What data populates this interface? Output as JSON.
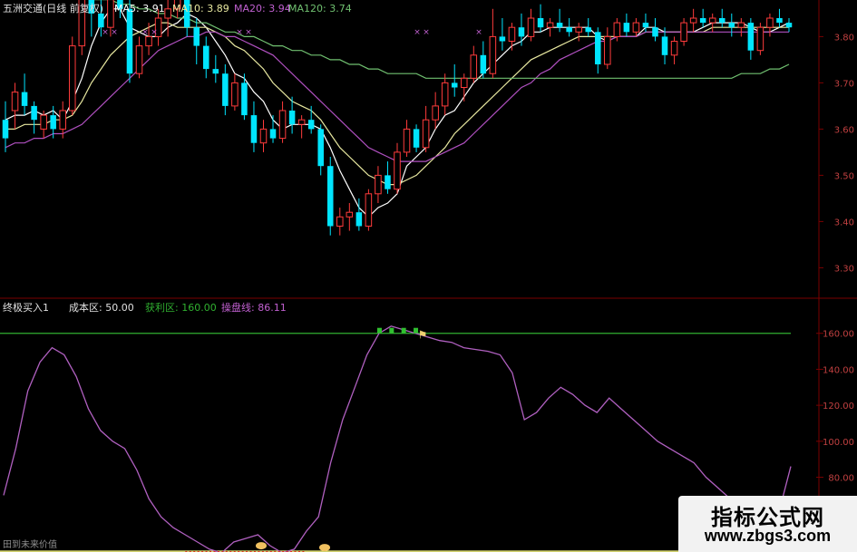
{
  "header": {
    "stock_name": "五洲交通(日线 前复权)",
    "ma5": "MA5: 3.91",
    "ma10": "MA10: 3.89",
    "ma20": "MA20: 3.94",
    "ma120": "MA120: 3.74"
  },
  "indicator_header": {
    "name": "终极买入1",
    "cost": "成本区: 50.00",
    "profit": "获利区: 160.00",
    "line": "操盘线: 86.11"
  },
  "bottom_label": "田到未来价值",
  "watermark": {
    "line1": "指标公式网",
    "line2": "www.zbgs3.com"
  },
  "colors": {
    "up": "#ff3b3b",
    "down": "#00e5ff",
    "ma5": "#ffffff",
    "ma10": "#e8e8a0",
    "ma20": "#b050c0",
    "ma120": "#70c070",
    "osc": "#b060c0",
    "grid": "#7a0000",
    "axis_text": "#c04040",
    "green_line": "#30b030",
    "yellow_line": "#f0f080"
  },
  "chart_data": [
    {
      "type": "candlestick",
      "title": "五洲交通(日线 前复权)",
      "yticks": [
        3.3,
        3.4,
        3.5,
        3.6,
        3.7,
        3.8
      ],
      "ylim": [
        3.24,
        3.84
      ],
      "ohlc": [
        [
          3.62,
          3.66,
          3.55,
          3.58
        ],
        [
          3.64,
          3.7,
          3.6,
          3.68
        ],
        [
          3.68,
          3.72,
          3.63,
          3.65
        ],
        [
          3.65,
          3.66,
          3.59,
          3.62
        ],
        [
          3.6,
          3.64,
          3.58,
          3.63
        ],
        [
          3.63,
          3.65,
          3.58,
          3.6
        ],
        [
          3.6,
          3.66,
          3.58,
          3.64
        ],
        [
          3.64,
          3.8,
          3.63,
          3.78
        ],
        [
          3.78,
          3.93,
          3.76,
          3.9
        ],
        [
          3.9,
          3.94,
          3.8,
          3.85
        ],
        [
          3.85,
          3.88,
          3.8,
          3.82
        ],
        [
          3.82,
          3.92,
          3.8,
          3.88
        ],
        [
          3.88,
          3.98,
          3.84,
          3.86
        ],
        [
          3.86,
          3.9,
          3.7,
          3.72
        ],
        [
          3.72,
          3.8,
          3.71,
          3.78
        ],
        [
          3.78,
          3.83,
          3.76,
          3.8
        ],
        [
          3.8,
          3.86,
          3.78,
          3.84
        ],
        [
          3.84,
          3.89,
          3.8,
          3.86
        ],
        [
          3.86,
          3.91,
          3.84,
          3.89
        ],
        [
          3.89,
          3.92,
          3.8,
          3.82
        ],
        [
          3.82,
          3.84,
          3.74,
          3.78
        ],
        [
          3.78,
          3.8,
          3.71,
          3.73
        ],
        [
          3.73,
          3.76,
          3.7,
          3.72
        ],
        [
          3.72,
          3.74,
          3.63,
          3.65
        ],
        [
          3.65,
          3.72,
          3.64,
          3.7
        ],
        [
          3.7,
          3.72,
          3.62,
          3.63
        ],
        [
          3.63,
          3.66,
          3.55,
          3.57
        ],
        [
          3.57,
          3.62,
          3.55,
          3.6
        ],
        [
          3.6,
          3.63,
          3.57,
          3.58
        ],
        [
          3.58,
          3.66,
          3.57,
          3.64
        ],
        [
          3.64,
          3.67,
          3.59,
          3.61
        ],
        [
          3.61,
          3.63,
          3.58,
          3.62
        ],
        [
          3.62,
          3.65,
          3.59,
          3.6
        ],
        [
          3.6,
          3.61,
          3.5,
          3.52
        ],
        [
          3.52,
          3.54,
          3.37,
          3.39
        ],
        [
          3.39,
          3.43,
          3.37,
          3.41
        ],
        [
          3.41,
          3.44,
          3.38,
          3.42
        ],
        [
          3.42,
          3.45,
          3.38,
          3.39
        ],
        [
          3.39,
          3.47,
          3.38,
          3.46
        ],
        [
          3.46,
          3.52,
          3.44,
          3.5
        ],
        [
          3.5,
          3.53,
          3.46,
          3.47
        ],
        [
          3.47,
          3.57,
          3.46,
          3.55
        ],
        [
          3.55,
          3.62,
          3.54,
          3.6
        ],
        [
          3.6,
          3.61,
          3.55,
          3.56
        ],
        [
          3.56,
          3.65,
          3.55,
          3.62
        ],
        [
          3.62,
          3.68,
          3.6,
          3.65
        ],
        [
          3.65,
          3.72,
          3.63,
          3.7
        ],
        [
          3.7,
          3.74,
          3.67,
          3.69
        ],
        [
          3.69,
          3.72,
          3.66,
          3.71
        ],
        [
          3.71,
          3.78,
          3.7,
          3.76
        ],
        [
          3.76,
          3.79,
          3.71,
          3.72
        ],
        [
          3.72,
          3.86,
          3.71,
          3.8
        ],
        [
          3.8,
          3.84,
          3.77,
          3.79
        ],
        [
          3.79,
          3.83,
          3.77,
          3.82
        ],
        [
          3.82,
          3.85,
          3.78,
          3.8
        ],
        [
          3.8,
          3.86,
          3.79,
          3.84
        ],
        [
          3.84,
          3.87,
          3.81,
          3.82
        ],
        [
          3.82,
          3.84,
          3.8,
          3.83
        ],
        [
          3.83,
          3.86,
          3.81,
          3.82
        ],
        [
          3.82,
          3.84,
          3.8,
          3.81
        ],
        [
          3.81,
          3.83,
          3.79,
          3.82
        ],
        [
          3.82,
          3.84,
          3.8,
          3.81
        ],
        [
          3.81,
          3.82,
          3.72,
          3.74
        ],
        [
          3.74,
          3.82,
          3.73,
          3.8
        ],
        [
          3.8,
          3.84,
          3.79,
          3.83
        ],
        [
          3.83,
          3.85,
          3.8,
          3.81
        ],
        [
          3.81,
          3.84,
          3.8,
          3.83
        ],
        [
          3.83,
          3.85,
          3.81,
          3.82
        ],
        [
          3.82,
          3.84,
          3.79,
          3.8
        ],
        [
          3.8,
          3.82,
          3.74,
          3.76
        ],
        [
          3.76,
          3.8,
          3.74,
          3.79
        ],
        [
          3.79,
          3.84,
          3.78,
          3.83
        ],
        [
          3.83,
          3.86,
          3.81,
          3.84
        ],
        [
          3.84,
          3.86,
          3.82,
          3.83
        ],
        [
          3.83,
          3.85,
          3.81,
          3.84
        ],
        [
          3.84,
          3.86,
          3.82,
          3.83
        ],
        [
          3.83,
          3.85,
          3.8,
          3.82
        ],
        [
          3.82,
          3.84,
          3.8,
          3.83
        ],
        [
          3.83,
          3.84,
          3.75,
          3.77
        ],
        [
          3.77,
          3.83,
          3.76,
          3.82
        ],
        [
          3.82,
          3.85,
          3.8,
          3.84
        ],
        [
          3.84,
          3.86,
          3.82,
          3.83
        ],
        [
          3.83,
          3.84,
          3.81,
          3.82
        ]
      ],
      "series": [
        {
          "name": "MA5",
          "values": [
            3.62,
            3.63,
            3.63,
            3.64,
            3.63,
            3.64,
            3.62,
            3.66,
            3.71,
            3.78,
            3.83,
            3.86,
            3.86,
            3.82,
            3.81,
            3.8,
            3.8,
            3.82,
            3.83,
            3.85,
            3.84,
            3.82,
            3.79,
            3.76,
            3.72,
            3.71,
            3.68,
            3.66,
            3.62,
            3.6,
            3.61,
            3.61,
            3.61,
            3.6,
            3.56,
            3.51,
            3.47,
            3.43,
            3.41,
            3.43,
            3.44,
            3.46,
            3.52,
            3.54,
            3.56,
            3.6,
            3.63,
            3.64,
            3.67,
            3.7,
            3.72,
            3.74,
            3.76,
            3.78,
            3.79,
            3.81,
            3.81,
            3.82,
            3.82,
            3.82,
            3.82,
            3.82,
            3.8,
            3.79,
            3.8,
            3.8,
            3.8,
            3.82,
            3.82,
            3.81,
            3.81,
            3.81,
            3.81,
            3.82,
            3.83,
            3.83,
            3.83,
            3.83,
            3.82,
            3.81,
            3.81,
            3.82,
            3.83
          ]
        },
        {
          "name": "MA10",
          "values": [
            3.6,
            3.6,
            3.61,
            3.61,
            3.61,
            3.62,
            3.62,
            3.63,
            3.66,
            3.7,
            3.73,
            3.76,
            3.78,
            3.8,
            3.81,
            3.82,
            3.83,
            3.83,
            3.82,
            3.82,
            3.82,
            3.82,
            3.81,
            3.8,
            3.78,
            3.77,
            3.75,
            3.73,
            3.7,
            3.68,
            3.66,
            3.65,
            3.64,
            3.62,
            3.59,
            3.56,
            3.54,
            3.52,
            3.5,
            3.49,
            3.48,
            3.48,
            3.49,
            3.5,
            3.52,
            3.54,
            3.56,
            3.59,
            3.61,
            3.63,
            3.65,
            3.67,
            3.69,
            3.71,
            3.73,
            3.75,
            3.76,
            3.77,
            3.78,
            3.79,
            3.8,
            3.8,
            3.8,
            3.8,
            3.8,
            3.8,
            3.8,
            3.81,
            3.81,
            3.81,
            3.81,
            3.81,
            3.81,
            3.81,
            3.82,
            3.82,
            3.82,
            3.82,
            3.82,
            3.82,
            3.82,
            3.82,
            3.82
          ]
        },
        {
          "name": "MA20",
          "values": [
            3.56,
            3.57,
            3.57,
            3.58,
            3.58,
            3.59,
            3.59,
            3.6,
            3.61,
            3.63,
            3.65,
            3.67,
            3.69,
            3.71,
            3.73,
            3.75,
            3.77,
            3.78,
            3.79,
            3.8,
            3.8,
            3.81,
            3.81,
            3.8,
            3.8,
            3.79,
            3.78,
            3.77,
            3.76,
            3.74,
            3.72,
            3.7,
            3.68,
            3.66,
            3.64,
            3.62,
            3.6,
            3.58,
            3.56,
            3.55,
            3.54,
            3.53,
            3.53,
            3.53,
            3.53,
            3.54,
            3.55,
            3.56,
            3.57,
            3.59,
            3.61,
            3.63,
            3.65,
            3.67,
            3.69,
            3.7,
            3.72,
            3.73,
            3.75,
            3.76,
            3.77,
            3.78,
            3.79,
            3.79,
            3.8,
            3.8,
            3.8,
            3.81,
            3.81,
            3.81,
            3.81,
            3.81,
            3.81,
            3.81,
            3.81,
            3.81,
            3.81,
            3.81,
            3.81,
            3.81,
            3.81,
            3.81,
            3.81
          ]
        },
        {
          "name": "MA120",
          "values": [
            3.91,
            3.91,
            3.91,
            3.9,
            3.9,
            3.9,
            3.89,
            3.89,
            3.89,
            3.88,
            3.88,
            3.88,
            3.87,
            3.87,
            3.86,
            3.86,
            3.85,
            3.85,
            3.84,
            3.84,
            3.83,
            3.83,
            3.82,
            3.81,
            3.81,
            3.8,
            3.8,
            3.79,
            3.78,
            3.78,
            3.77,
            3.77,
            3.76,
            3.76,
            3.75,
            3.75,
            3.74,
            3.74,
            3.73,
            3.73,
            3.72,
            3.72,
            3.72,
            3.72,
            3.71,
            3.71,
            3.71,
            3.71,
            3.71,
            3.71,
            3.71,
            3.71,
            3.71,
            3.71,
            3.71,
            3.71,
            3.71,
            3.71,
            3.71,
            3.71,
            3.71,
            3.71,
            3.71,
            3.71,
            3.71,
            3.71,
            3.71,
            3.71,
            3.71,
            3.71,
            3.71,
            3.71,
            3.71,
            3.71,
            3.71,
            3.71,
            3.71,
            3.72,
            3.72,
            3.72,
            3.73,
            3.73,
            3.74
          ]
        }
      ]
    },
    {
      "type": "line",
      "title": "终极买入1",
      "yticks": [
        80.0,
        100.0,
        120.0,
        140.0,
        160.0
      ],
      "ylim": [
        45,
        178
      ],
      "reference_lines": [
        160,
        50
      ],
      "series": [
        {
          "name": "操盘线",
          "values": [
            70,
            96,
            128,
            144,
            152,
            148,
            136,
            118,
            106,
            100,
            96,
            84,
            68,
            58,
            52,
            48,
            44,
            40,
            38,
            44,
            46,
            48,
            42,
            38,
            40,
            50,
            58,
            88,
            112,
            130,
            148,
            160,
            164,
            162,
            160,
            158,
            156,
            155,
            152,
            151,
            150,
            148,
            138,
            112,
            116,
            124,
            130,
            126,
            120,
            116,
            124,
            118,
            112,
            106,
            100,
            96,
            92,
            88,
            80,
            74,
            68,
            62,
            58,
            56,
            60,
            86
          ]
        }
      ]
    }
  ]
}
